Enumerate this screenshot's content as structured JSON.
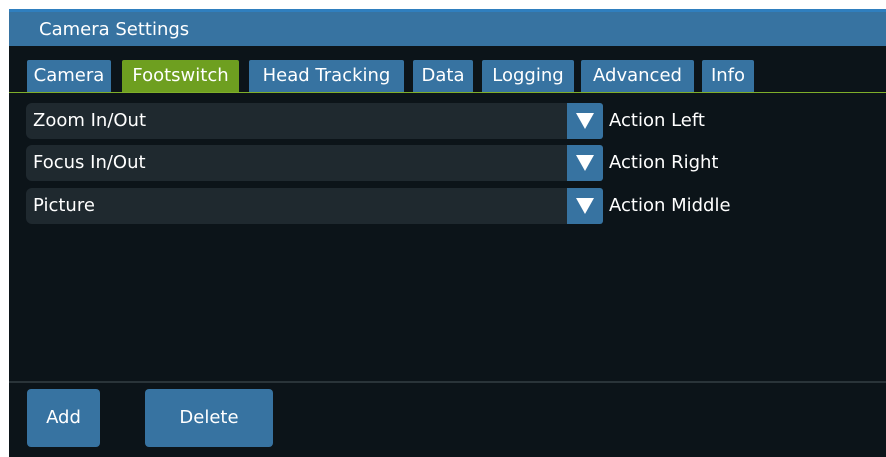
{
  "window": {
    "title": "Camera Settings"
  },
  "tabs": [
    {
      "label": "Camera"
    },
    {
      "label": "Footswitch",
      "active": true
    },
    {
      "label": "Head Tracking"
    },
    {
      "label": "Data"
    },
    {
      "label": "Logging"
    },
    {
      "label": "Advanced"
    },
    {
      "label": "Info"
    }
  ],
  "mappings": [
    {
      "value": "Zoom In/Out",
      "action": "Action Left"
    },
    {
      "value": "Focus In/Out",
      "action": "Action Right"
    },
    {
      "value": "Picture",
      "action": "Action Middle"
    }
  ],
  "footer": {
    "add_label": "Add",
    "delete_label": "Delete"
  },
  "colors": {
    "accent": "#3773a1",
    "active_tab": "#6e9f20",
    "background": "#0c1419",
    "field": "#1f292f"
  },
  "icons": {
    "dropdown": "triangle-down-icon"
  }
}
